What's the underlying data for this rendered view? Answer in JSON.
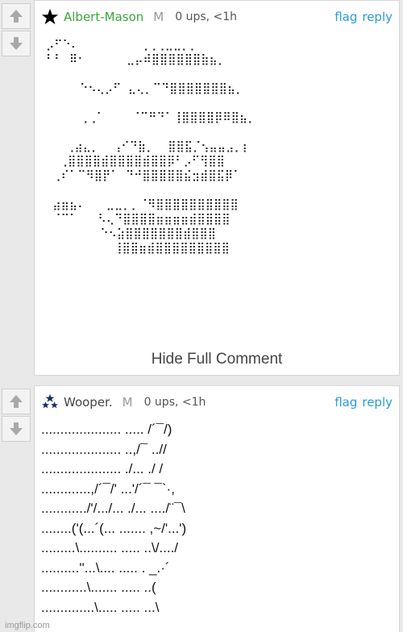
{
  "comments": [
    {
      "username": "Albert-Mason",
      "mod_mark": "M",
      "meta": "0 ups, <1h",
      "flag": "flag",
      "reply": "reply",
      "icon": "black-star-icon",
      "body_lines": [
        "⡠⠋⠑⠄         ⢀⢀⢀⣀⣀⡀⡀",
        "⠃⠃ ⠿⠂      ⣀⡤⠾⣿⣿⣿⣿⣿⣿⣷⣦⡀",
        "",
        "     ⠑⠢⢄⡠⠋ ⣄⢄⡀⠉⠙⣿⣿⣿⣿⣿⣿⣿⣦⡀",
        "",
        "     ⢀⢀⠁    ⠈⠉⠛⠙⠁⢸⣿⣿⣿⣿⡿⠿⣿⣦⡀",
        "",
        "   ⢀⣴⣄⡀  ⢠⠊⠙⣷⡀  ⣿⣿⣯⡈⢢⣤⣤⣠⡀⡆",
        "  ⢀⣿⣿⣿⣿⣾⣿⣿⣿⣿⣾⣿⣿⡿⠃⡠⠋⢻⣿⣿",
        " ⢀⠎⠁⠉⠻⣿⡟⠁ ⠙⠚⣿⣿⣿⣿⣿⣮⣲⣾⣿⣯⡿⠁",
        "",
        " ⣴⣶⣦⠄   ⣀⣀⡀⡀⠈⠻⣿⣿⣿⣿⣿⣿⣿⣿⣿⣿",
        " ⠈⠉⠁   ⠣⢄⠙⣿⣿⣿⣿⣶⣶⣶⣶⣾⣿⣿⣿⣿",
        "        ⠑⠢⣵⣿⣿⣿⣿⣿⣿⣿⣾⣿⣿⣿",
        "          ⢸⣿⣿⣶⣾⣿⣿⣿⣿⣿⣿⣿⣿⣿"
      ],
      "hide_label": "Hide Full Comment"
    },
    {
      "username": "Wooper.",
      "mod_mark": "M",
      "meta": "0 ups, <1h",
      "flag": "flag",
      "reply": "reply",
      "icon": "tri-star-icon",
      "body_lines": [
        "..................... ..... /´¯/)",
        "..................... ..,/¯ ..//",
        "..................... ./... ./ /",
        ".............,/´¯/' ...'/´¯ ¯`·,",
        "............/'/.../... ./... ..../¨¯\\",
        "........('(...´(... ....... ,~/'...')",
        ".........\\.......... ..... ..\\/..../",
        "..........''...\\.... ..... . _.·´",
        "............\\....... ..... ..(",
        "..............\\..... ..... ...\\"
      ]
    }
  ],
  "watermark": "imgflip.com"
}
